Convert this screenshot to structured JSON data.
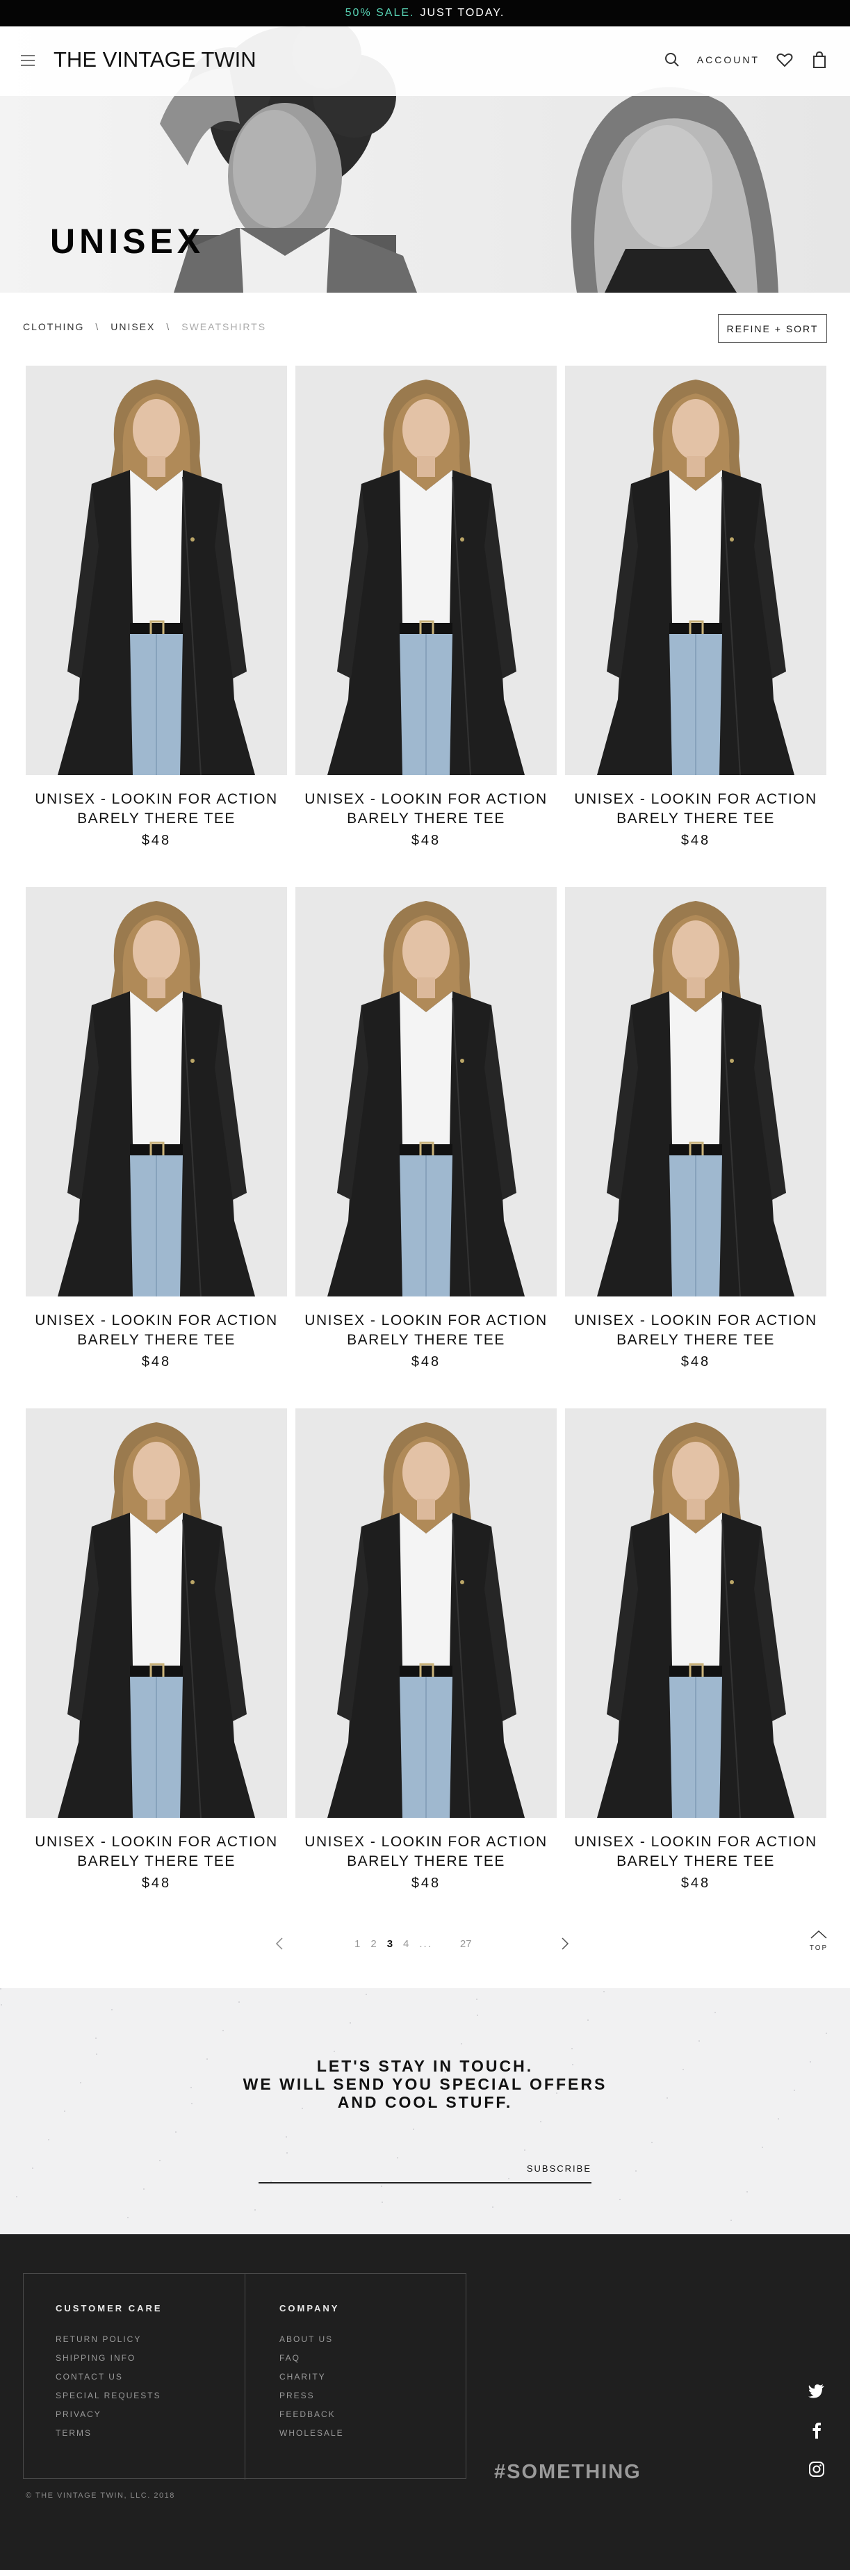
{
  "promo": {
    "accent": "50% SALE.",
    "text": "JUST TODAY.",
    "accent_color": "#58d2b4"
  },
  "header": {
    "logo": "THE VINTAGE TWIN",
    "account_label": "ACCOUNT",
    "icons": [
      "menu-icon",
      "search-icon",
      "heart-icon",
      "bag-icon"
    ]
  },
  "hero": {
    "title": "UNISEX"
  },
  "breadcrumb": {
    "items": [
      "CLOTHING",
      "UNISEX",
      "SWEATSHIRTS"
    ],
    "separator": "\\"
  },
  "refine_label": "REFINE + SORT",
  "products": [
    {
      "name_line1": "UNISEX - LOOKIN FOR ACTION",
      "name_line2": "BARELY THERE TEE",
      "price": "$48"
    },
    {
      "name_line1": "UNISEX - LOOKIN FOR ACTION",
      "name_line2": "BARELY THERE TEE",
      "price": "$48"
    },
    {
      "name_line1": "UNISEX - LOOKIN FOR ACTION",
      "name_line2": "BARELY THERE TEE",
      "price": "$48"
    },
    {
      "name_line1": "UNISEX - LOOKIN FOR ACTION",
      "name_line2": "BARELY THERE TEE",
      "price": "$48"
    },
    {
      "name_line1": "UNISEX - LOOKIN FOR ACTION",
      "name_line2": "BARELY THERE TEE",
      "price": "$48"
    },
    {
      "name_line1": "UNISEX - LOOKIN FOR ACTION",
      "name_line2": "BARELY THERE TEE",
      "price": "$48"
    },
    {
      "name_line1": "UNISEX - LOOKIN FOR ACTION",
      "name_line2": "BARELY THERE TEE",
      "price": "$48"
    },
    {
      "name_line1": "UNISEX - LOOKIN FOR ACTION",
      "name_line2": "BARELY THERE TEE",
      "price": "$48"
    },
    {
      "name_line1": "UNISEX - LOOKIN FOR ACTION",
      "name_line2": "BARELY THERE TEE",
      "price": "$48"
    }
  ],
  "pagination": {
    "pages": [
      "1",
      "2",
      "3",
      "4"
    ],
    "current": "3",
    "ellipsis": "...",
    "last": "27"
  },
  "to_top_label": "TOP",
  "newsletter": {
    "line1": "LET'S STAY IN TOUCH.",
    "line2": "WE WILL SEND YOU SPECIAL OFFERS",
    "line3": "AND COOL STUFF.",
    "subscribe_label": "SUBSCRIBE"
  },
  "footer": {
    "customer_care": {
      "heading": "CUSTOMER CARE",
      "links": [
        "RETURN POLICY",
        "SHIPPING INFO",
        "CONTACT US",
        "SPECIAL REQUESTS",
        "PRIVACY",
        "TERMS"
      ]
    },
    "company": {
      "heading": "COMPANY",
      "links": [
        "ABOUT US",
        "FAQ",
        "CHARITY",
        "PRESS",
        "FEEDBACK",
        "WHOLESALE"
      ]
    },
    "hashtag": "#SOMETHING",
    "copyright": "© THE VINTAGE TWIN, LLC. 2018",
    "social": [
      "twitter-icon",
      "facebook-icon",
      "instagram-icon"
    ]
  }
}
